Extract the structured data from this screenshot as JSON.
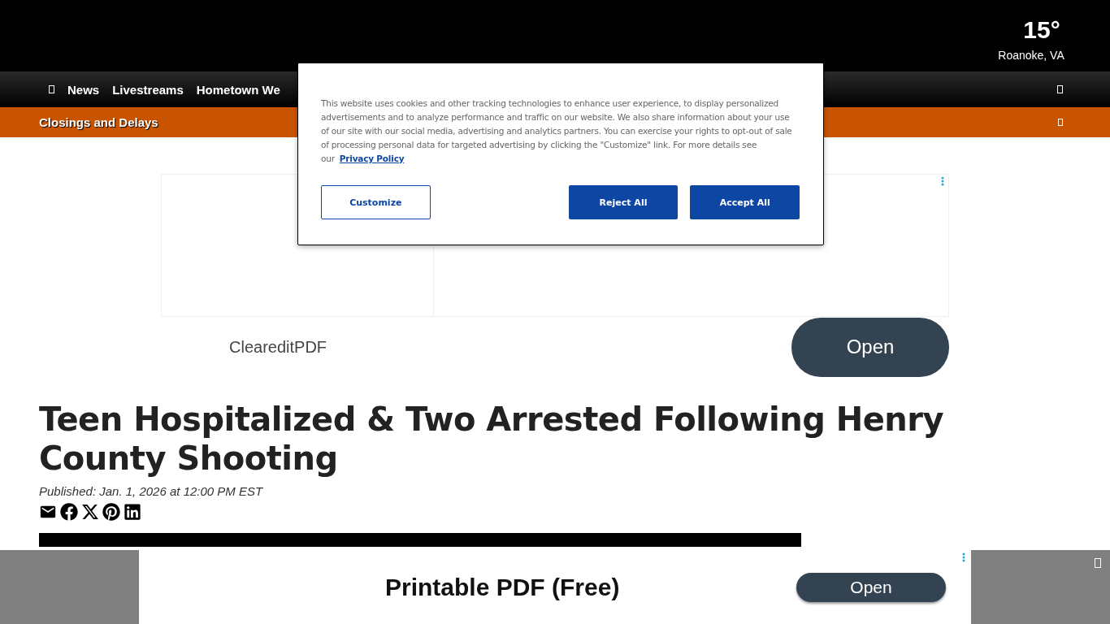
{
  "header": {
    "temperature": "15°",
    "location": "Roanoke, VA"
  },
  "nav": {
    "items": [
      "News",
      "Livestreams",
      "Hometown We"
    ]
  },
  "alert_bar": {
    "label": "Closings and Delays"
  },
  "ad": {
    "advertiser": "CleareditPDF",
    "button": "Open"
  },
  "article": {
    "title": "Teen Hospitalized & Two Arrested Following Henry County Shooting",
    "published": "Published: Jan. 1, 2026 at 12:00 PM EST",
    "share": [
      {
        "kind": "email"
      },
      {
        "kind": "facebook"
      },
      {
        "kind": "x"
      },
      {
        "kind": "pinterest"
      },
      {
        "kind": "linkedin"
      }
    ]
  },
  "sticky_ad": {
    "headline": "Printable PDF (Free)",
    "button": "Open"
  },
  "cookie_banner": {
    "text": "This website uses cookies and other tracking technologies to enhance user experience, to display personalized advertisements and to analyze performance and traffic on our website. We also share information about your use of our site with our social media, advertising and analytics partners. You can exercise your rights to opt-out of sale of processing personal data for targeted advertising by clicking the \"Customize\" link. For more details see our",
    "link": "Privacy Policy",
    "buttons": [
      {
        "label": "Customize",
        "kind": "outline"
      },
      {
        "label": "Reject All",
        "kind": "solid"
      },
      {
        "label": "Accept All",
        "kind": "solid"
      }
    ]
  }
}
